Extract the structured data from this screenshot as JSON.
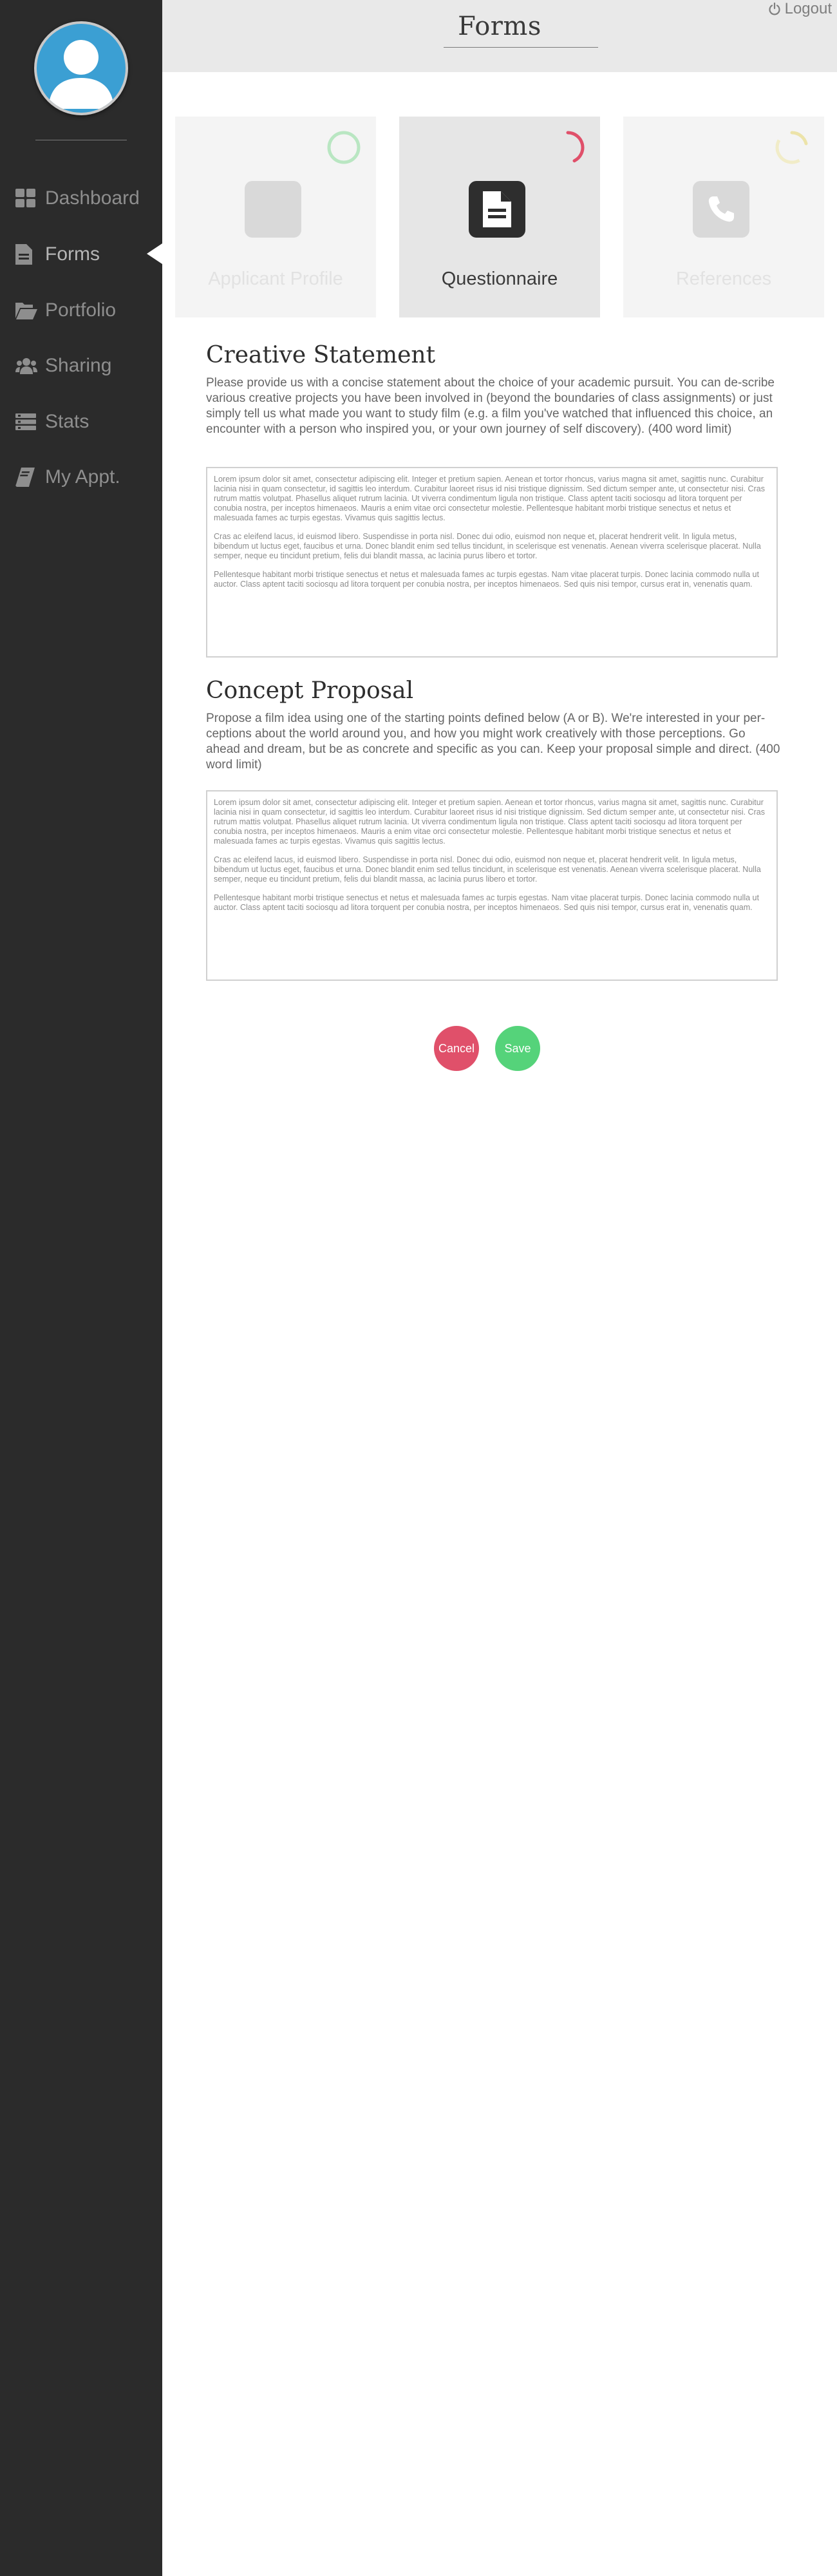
{
  "header": {
    "title": "Forms",
    "logout_label": "Logout"
  },
  "sidebar": {
    "items": [
      {
        "label": "Dashboard",
        "icon": "dashboard-icon"
      },
      {
        "label": "Forms",
        "icon": "file-icon",
        "active": true
      },
      {
        "label": "Portfolio",
        "icon": "folder-open-icon"
      },
      {
        "label": "Sharing",
        "icon": "users-icon"
      },
      {
        "label": "Stats",
        "icon": "list-icon"
      },
      {
        "label": "My Appt.",
        "icon": "book-icon"
      }
    ]
  },
  "steps": [
    {
      "label": "Applicant Profile",
      "icon": "file-icon",
      "ring_color": "#b9e6c2"
    },
    {
      "label": "Questionnaire",
      "icon": "file-icon",
      "ring_color": "#e0506a",
      "active": true
    },
    {
      "label": "References",
      "icon": "phone-icon",
      "ring_color": "#ece3a9"
    }
  ],
  "sections": [
    {
      "title": "Creative Statement",
      "description": "Please provide us with a concise statement about the choice of your academic pursuit. You can de-scribe various creative projects you have been involved in (beyond the boundaries of class assignments) or just simply tell us what made you want to study film (e.g. a film you've watched that influenced this choice, an encounter with a person who inspired you, or your own journey of self discovery). (400 word limit)",
      "paragraphs": [
        "Lorem ipsum dolor sit amet, consectetur adipiscing elit. Integer et pretium sapien. Aenean et tortor rhoncus, varius magna sit amet, sagittis nunc. Curabitur lacinia nisi in quam consectetur, id sagittis leo interdum. Curabitur laoreet risus id nisi tristique dignissim. Sed dictum semper ante, ut consectetur nisi. Cras rutrum mattis volutpat. Phasellus aliquet rutrum lacinia. Ut viverra condimentum ligula non tristique. Class aptent taciti sociosqu ad litora torquent per conubia nostra, per inceptos himenaeos. Mauris a enim vitae orci consectetur molestie. Pellentesque habitant morbi tristique senectus et netus et malesuada fames ac turpis egestas. Vivamus quis sagittis lectus.",
        "Cras ac eleifend lacus, id euismod libero. Suspendisse in porta nisl. Donec dui odio, euismod non neque et, placerat hendrerit velit. In ligula metus, bibendum ut luctus eget, faucibus et urna. Donec blandit enim sed tellus tincidunt, in scelerisque est venenatis. Aenean viverra scelerisque placerat. Nulla semper, neque eu tincidunt pretium, felis dui blandit massa, ac lacinia purus libero et tortor.",
        "Pellentesque habitant morbi tristique senectus et netus et malesuada fames ac turpis egestas. Nam vitae placerat turpis. Donec lacinia commodo nulla ut auctor. Class aptent taciti sociosqu ad litora torquent per conubia nostra, per inceptos himenaeos. Sed quis nisi tempor, cursus erat in, venenatis quam."
      ]
    },
    {
      "title": "Concept Proposal",
      "description": "Propose a film idea using one of the starting points defined below (A or B). We're interested in your per-ceptions about the world around you, and how you might work creatively with those perceptions. Go ahead and dream, but be as concrete and specific as you can. Keep your proposal simple and direct. (400 word limit)",
      "paragraphs": [
        "Lorem ipsum dolor sit amet, consectetur adipiscing elit. Integer et pretium sapien. Aenean et tortor rhoncus, varius magna sit amet, sagittis nunc. Curabitur lacinia nisi in quam consectetur, id sagittis leo interdum. Curabitur laoreet risus id nisi tristique dignissim. Sed dictum semper ante, ut consectetur nisi. Cras rutrum mattis volutpat. Phasellus aliquet rutrum lacinia. Ut viverra condimentum ligula non tristique. Class aptent taciti sociosqu ad litora torquent per conubia nostra, per inceptos himenaeos. Mauris a enim vitae orci consectetur molestie. Pellentesque habitant morbi tristique senectus et netus et malesuada fames ac turpis egestas. Vivamus quis sagittis lectus.",
        "Cras ac eleifend lacus, id euismod libero. Suspendisse in porta nisl. Donec dui odio, euismod non neque et, placerat hendrerit velit. In ligula metus, bibendum ut luctus eget, faucibus et urna. Donec blandit enim sed tellus tincidunt, in scelerisque est venenatis. Aenean viverra scelerisque placerat. Nulla semper, neque eu tincidunt pretium, felis dui blandit massa, ac lacinia purus libero et tortor.",
        "Pellentesque habitant morbi tristique senectus et netus et malesuada fames ac turpis egestas. Nam vitae placerat turpis. Donec lacinia commodo nulla ut auctor. Class aptent taciti sociosqu ad litora torquent per conubia nostra, per inceptos himenaeos. Sed quis nisi tempor, cursus erat in, venenatis quam."
      ]
    }
  ],
  "actions": {
    "cancel_label": "Cancel",
    "save_label": "Save"
  },
  "colors": {
    "sidebar": "#2b2b2b",
    "cancel": "#e0506a",
    "save": "#55d37a",
    "avatar": "#3b9fd3"
  }
}
